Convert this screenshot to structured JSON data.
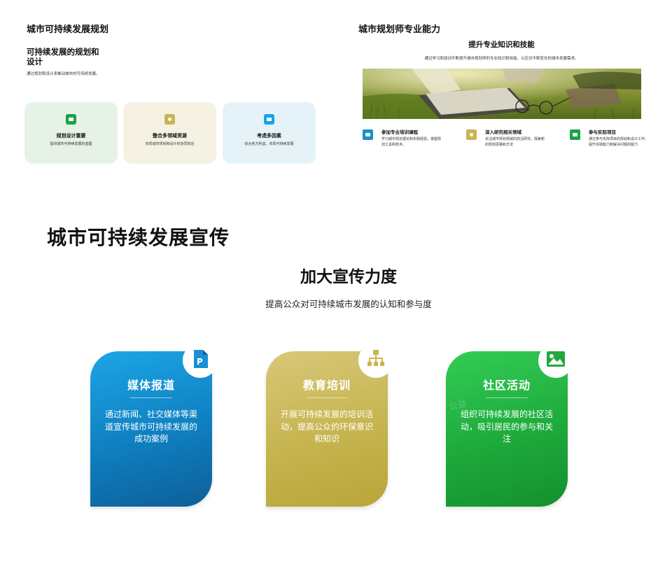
{
  "slide1": {
    "title": "城市可持续发展规划",
    "subtitle": "可持续发展的规划和设计",
    "description": "通过规划和设计来推动城市的可持续发展。",
    "cards": [
      {
        "title": "规划设计重要",
        "desc": "提供城市可持续发展的蓝图",
        "bg": "#e7f2e6",
        "icon": "briefcase-icon",
        "icon_color": "#1aa34a"
      },
      {
        "title": "整合多领域资源",
        "desc": "实现城市规划和设计的协同效应",
        "bg": "#f6f2e3",
        "icon": "pin-icon",
        "icon_color": "#c9b451"
      },
      {
        "title": "考虑多因素",
        "desc": "综合各方利益，实现可持续发展",
        "bg": "#e5f3f9",
        "icon": "monitor-icon",
        "icon_color": "#1ba4e0"
      }
    ]
  },
  "slide2": {
    "title": "城市规划师专业能力",
    "subtitle": "提升专业知识和技能",
    "description": "通过学习和培训不断提升城市规划师的专业知识和技能，以应对不断变化的城市发展需求。",
    "photo": "grass-books-glasses-photo",
    "items": [
      {
        "title": "参加专业培训课程",
        "desc": "学习城市规划理论和实践经验，掌握规划工具和技术。",
        "icon": "calendar-icon",
        "icon_color": "#1a8fc9"
      },
      {
        "title": "深入研究相关领域",
        "desc": "关注城市规划领域的前沿研究，探索新的规划思路和方法",
        "icon": "pin-icon",
        "icon_color": "#c9b451"
      },
      {
        "title": "参与实际项目",
        "desc": "通过参与实际项目的规划和设计工作，提升实践能力和解决问题的能力",
        "icon": "briefcase-icon",
        "icon_color": "#1aa34a"
      }
    ]
  },
  "slide3": {
    "title": "城市可持续发展宣传",
    "subtitle": "加大宣传力度",
    "description": "提高公众对可持续城市发展的认知和参与度",
    "cards": [
      {
        "title": "媒体报道",
        "desc": "通过新闻、社交媒体等渠道宣传城市可持续发展的成功案例",
        "icon": "document-p-icon",
        "color_top": "#1ca6e6",
        "color_bottom": "#0d5f98"
      },
      {
        "title": "教育培训",
        "desc": "开展可持续发展的培训活动，提高公众的环保意识和知识",
        "icon": "hierarchy-icon",
        "color_top": "#d6c572",
        "color_bottom": "#bba83e"
      },
      {
        "title": "社区活动",
        "desc": "组织可持续发展的社区活动，吸引居民的参与和关注",
        "icon": "image-icon",
        "color_top": "#2fc850",
        "color_bottom": "#15932e"
      }
    ]
  }
}
